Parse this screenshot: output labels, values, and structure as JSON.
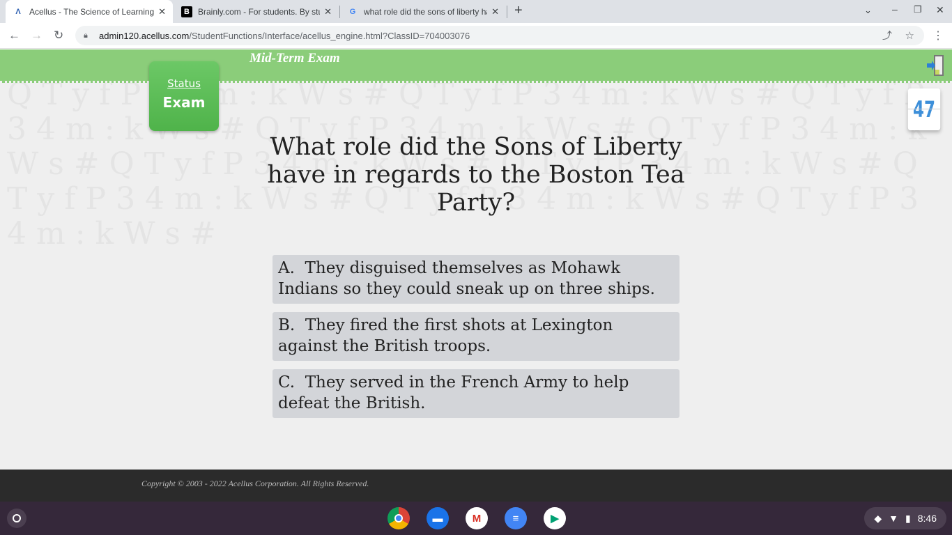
{
  "browser": {
    "tabs": [
      {
        "title": "Acellus - The Science of Learning",
        "icon": "acellus-icon",
        "active": true
      },
      {
        "title": "Brainly.com - For students. By students.",
        "icon": "brainly-icon",
        "active": false
      },
      {
        "title": "what role did the sons of liberty have",
        "icon": "google-icon",
        "active": false
      }
    ],
    "url_domain": "admin120.acellus.com",
    "url_path": "/StudentFunctions/Interface/acellus_engine.html?ClassID=704003076"
  },
  "header": {
    "title": "Mid-Term Exam",
    "status_label": "Status",
    "status_value": "Exam",
    "counter": "47"
  },
  "question": "What role did the Sons of Liberty have in regards to the Boston Tea Party?",
  "answers": [
    {
      "letter": "A.",
      "text": "They disguised themselves as Mohawk Indians so they could sneak up on three ships."
    },
    {
      "letter": "B.",
      "text": "They fired the first shots at Lexington against the British troops."
    },
    {
      "letter": "C.",
      "text": "They served in the French Army to help defeat the British."
    }
  ],
  "footer": {
    "copyright": "Copyright © 2003 - 2022 Acellus Corporation.  All Rights Reserved."
  },
  "shelf": {
    "apps": [
      "chrome-icon",
      "files-icon",
      "gmail-icon",
      "docs-icon",
      "play-store-icon"
    ],
    "time": "8:46"
  },
  "colors": {
    "header_green": "#8bcd7a",
    "status_green": "#55b84f",
    "counter_blue": "#3d8fd9"
  }
}
